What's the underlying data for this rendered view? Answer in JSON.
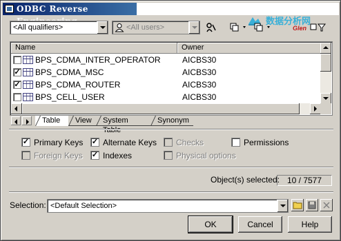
{
  "window": {
    "title": "ODBC Reverse Engineering",
    "watermark_text": "数据分析网",
    "watermark_sub": "Glen"
  },
  "toolbar": {
    "qualifier_value": "<All qualifiers>",
    "users_value": "<All users>",
    "icons": [
      "user-icon",
      "find-icon",
      "select-all-icon",
      "deselect-all-icon",
      "filter-icon"
    ]
  },
  "list": {
    "columns": [
      "Name",
      "Owner"
    ],
    "rows": [
      {
        "checked": false,
        "name": "BPS_CDMA_INTER_OPERATOR",
        "owner": "AICBS30"
      },
      {
        "checked": true,
        "name": "BPS_CDMA_MSC",
        "owner": "AICBS30"
      },
      {
        "checked": true,
        "name": "BPS_CDMA_ROUTER",
        "owner": "AICBS30"
      },
      {
        "checked": false,
        "name": "BPS_CELL_USER",
        "owner": "AICBS30"
      }
    ]
  },
  "tabs": [
    "Table",
    "View",
    "System Table",
    "Synonym"
  ],
  "active_tab": "Table",
  "options": {
    "primary_keys": {
      "label": "Primary Keys",
      "checked": true,
      "enabled": true
    },
    "alternate_keys": {
      "label": "Alternate Keys",
      "checked": true,
      "enabled": true
    },
    "checks": {
      "label": "Checks",
      "checked": false,
      "enabled": false
    },
    "permissions": {
      "label": "Permissions",
      "checked": false,
      "enabled": true
    },
    "foreign_keys": {
      "label": "Foreign Keys",
      "checked": false,
      "enabled": false
    },
    "indexes": {
      "label": "Indexes",
      "checked": true,
      "enabled": true
    },
    "physical_options": {
      "label": "Physical options",
      "checked": false,
      "enabled": false
    }
  },
  "status": {
    "selected_label": "Object(s) selected:",
    "selected_value": "10 / 7577"
  },
  "selection": {
    "label": "Selection:",
    "value": "<Default Selection>"
  },
  "buttons": {
    "ok": "OK",
    "cancel": "Cancel",
    "help": "Help"
  }
}
